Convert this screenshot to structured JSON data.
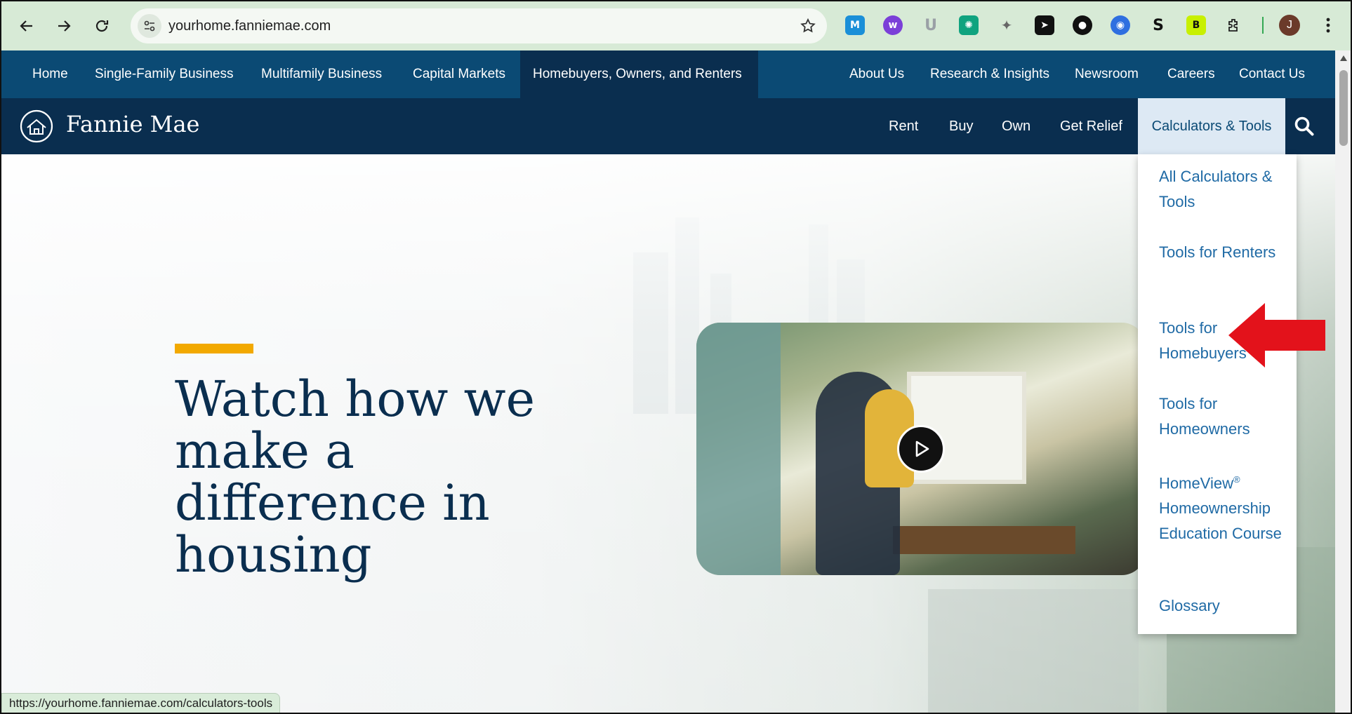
{
  "browser": {
    "url": "yourhome.fanniemae.com",
    "profile_initial": "J",
    "extensions": [
      "m-extension-icon",
      "w-extension-icon",
      "u-extension-icon",
      "gpt-extension-icon",
      "bird-extension-icon",
      "send-extension-icon",
      "dot-extension-icon",
      "circle-extension-icon",
      "s-extension-icon",
      "b-extension-icon",
      "puzzle-icon"
    ]
  },
  "topnav": {
    "items": [
      "Home",
      "Single-Family Business",
      "Multifamily Business",
      "Capital Markets",
      "Homebuyers, Owners, and Renters",
      "About Us",
      "Research & Insights",
      "Newsroom",
      "Careers",
      "Contact Us"
    ]
  },
  "header": {
    "logo": "Fannie Mae",
    "nav": [
      "Rent",
      "Buy",
      "Own",
      "Get Relief",
      "Calculators & Tools"
    ]
  },
  "dropdown": {
    "items": [
      "All Calculators & Tools",
      "Tools for Renters",
      "Tools for Homebuyers",
      "Tools for Homeowners",
      "HomeView",
      "Homeownership Education Course",
      "Glossary"
    ],
    "registered_mark": "®"
  },
  "hero": {
    "headline": "Watch how we make a difference in housing"
  },
  "status_bar": {
    "url": "https://yourhome.fanniemae.com/calculators-tools"
  },
  "colors": {
    "topnav_bg": "#0b4a74",
    "header_bg": "#0a2e4f",
    "accent": "#f2a900",
    "link": "#1f6aa5",
    "arrow": "#e3121b"
  }
}
